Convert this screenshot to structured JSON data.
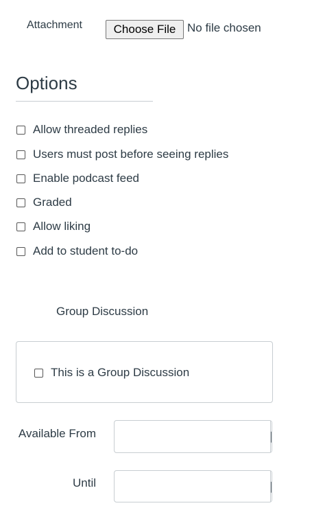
{
  "attachment": {
    "label": "Attachment",
    "button_label": "Choose File",
    "status": "No file chosen"
  },
  "options": {
    "title": "Options",
    "items": [
      {
        "label": "Allow threaded replies",
        "checked": false
      },
      {
        "label": "Users must post before seeing replies",
        "checked": false
      },
      {
        "label": "Enable podcast feed",
        "checked": false
      },
      {
        "label": "Graded",
        "checked": false
      },
      {
        "label": "Allow liking",
        "checked": false
      },
      {
        "label": "Add to student to-do",
        "checked": false
      }
    ]
  },
  "group": {
    "label": "Group Discussion",
    "checkbox_label": "This is a Group Discussion",
    "checked": false
  },
  "dates": {
    "available_from_label": "Available From",
    "available_from_value": "",
    "until_label": "Until",
    "until_value": "",
    "calendar_icon": "calendar-icon"
  }
}
